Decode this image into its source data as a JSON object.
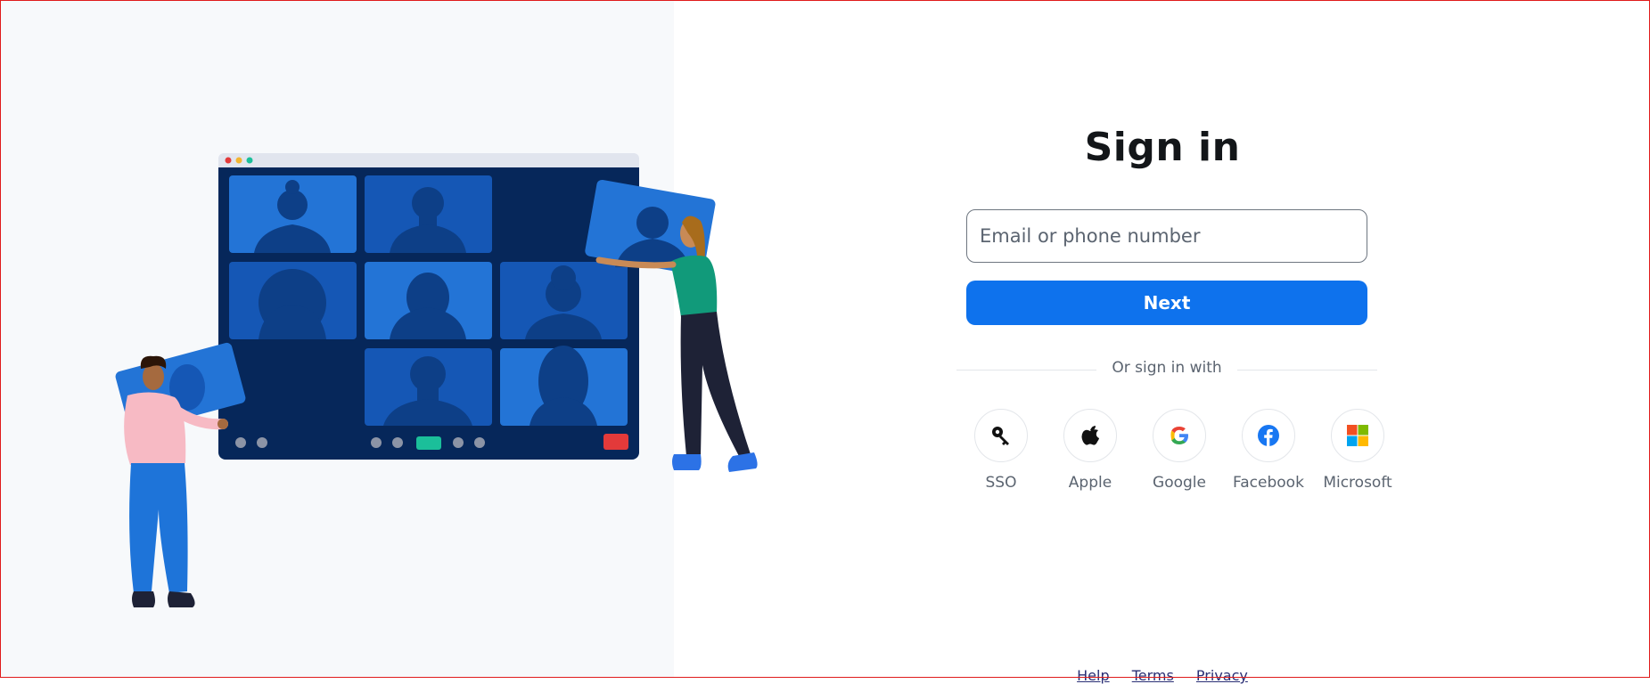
{
  "signin": {
    "title": "Sign in",
    "email_placeholder": "Email or phone number",
    "next_label": "Next",
    "divider_text": "Or sign in with"
  },
  "providers": [
    {
      "label": "SSO",
      "icon": "key-icon"
    },
    {
      "label": "Apple",
      "icon": "apple-icon"
    },
    {
      "label": "Google",
      "icon": "google-icon"
    },
    {
      "label": "Facebook",
      "icon": "facebook-icon"
    },
    {
      "label": "Microsoft",
      "icon": "microsoft-icon"
    }
  ],
  "footer": {
    "links": [
      "Help",
      "Terms",
      "Privacy"
    ]
  },
  "colors": {
    "primary": "#0e72ed",
    "left_panel_bg": "#f7f9fb",
    "screen_dark": "#06275a",
    "tile_blue": "#2374d6",
    "tile_mid": "#1557b5",
    "accent_green": "#1bbf9a",
    "alert_red": "#e33a3a"
  }
}
